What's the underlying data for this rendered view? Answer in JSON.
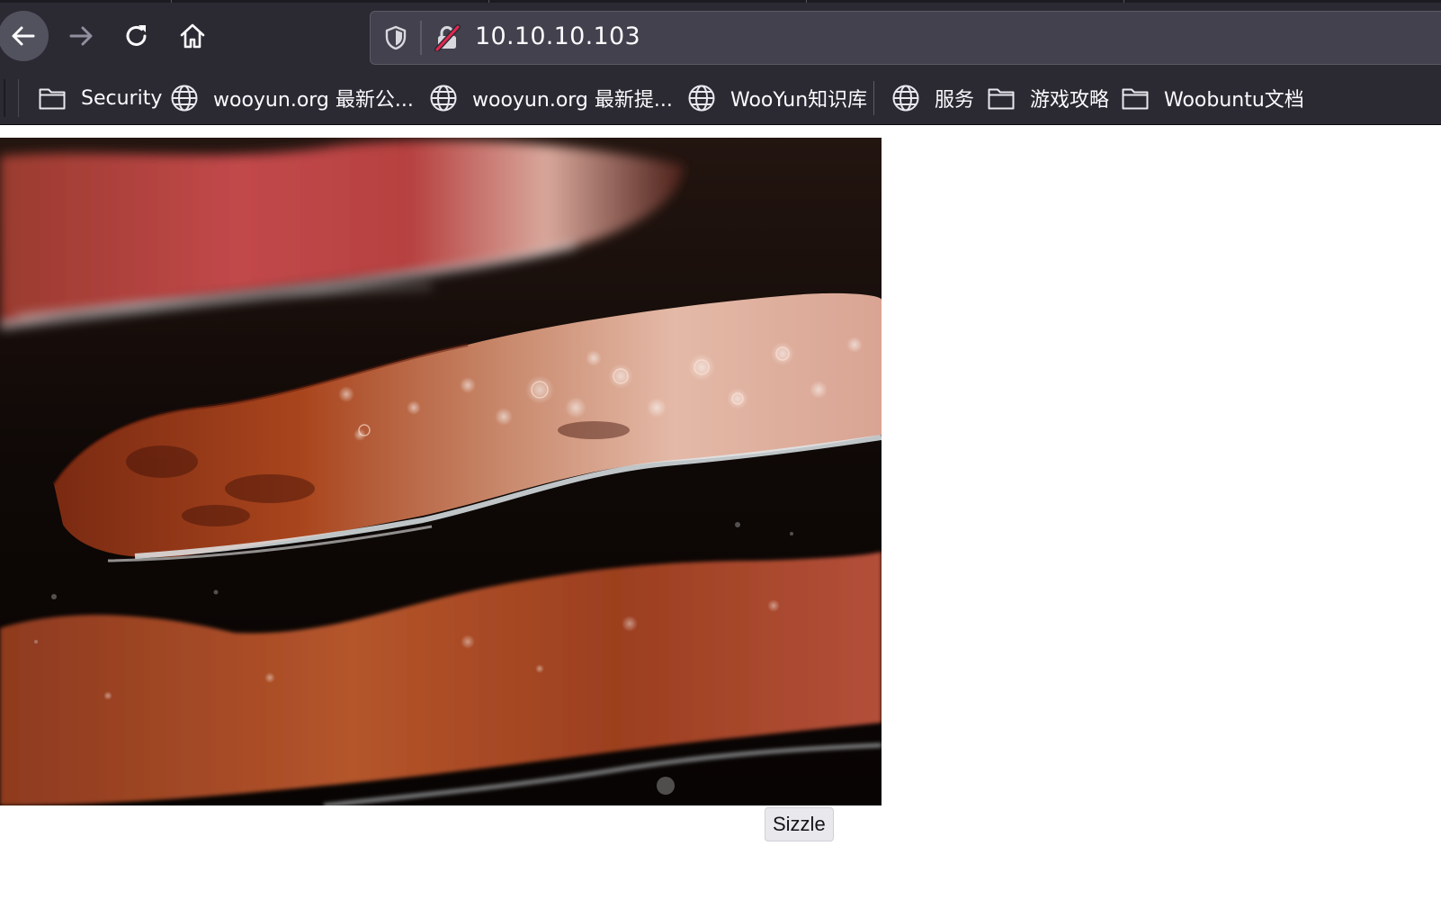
{
  "browser": {
    "url": "10.10.10.103",
    "bookmarks": [
      {
        "label": "Security",
        "icon": "folder-icon"
      },
      {
        "label": "wooyun.org 最新公...",
        "icon": "globe-icon"
      },
      {
        "label": "wooyun.org 最新提...",
        "icon": "globe-icon"
      },
      {
        "label": "WooYun知识库",
        "icon": "globe-icon"
      },
      {
        "label": "服务",
        "icon": "globe-icon"
      },
      {
        "label": "游戏攻略",
        "icon": "folder-icon"
      },
      {
        "label": "Woobuntu文档",
        "icon": "folder-icon"
      }
    ]
  },
  "page": {
    "image_subject": "bacon-strips-sizzling",
    "button_label": "Sizzle"
  },
  "colors": {
    "chrome_bg": "#2b2a33",
    "urlbar_bg": "#42414d",
    "insecure_accent": "#e22850"
  }
}
